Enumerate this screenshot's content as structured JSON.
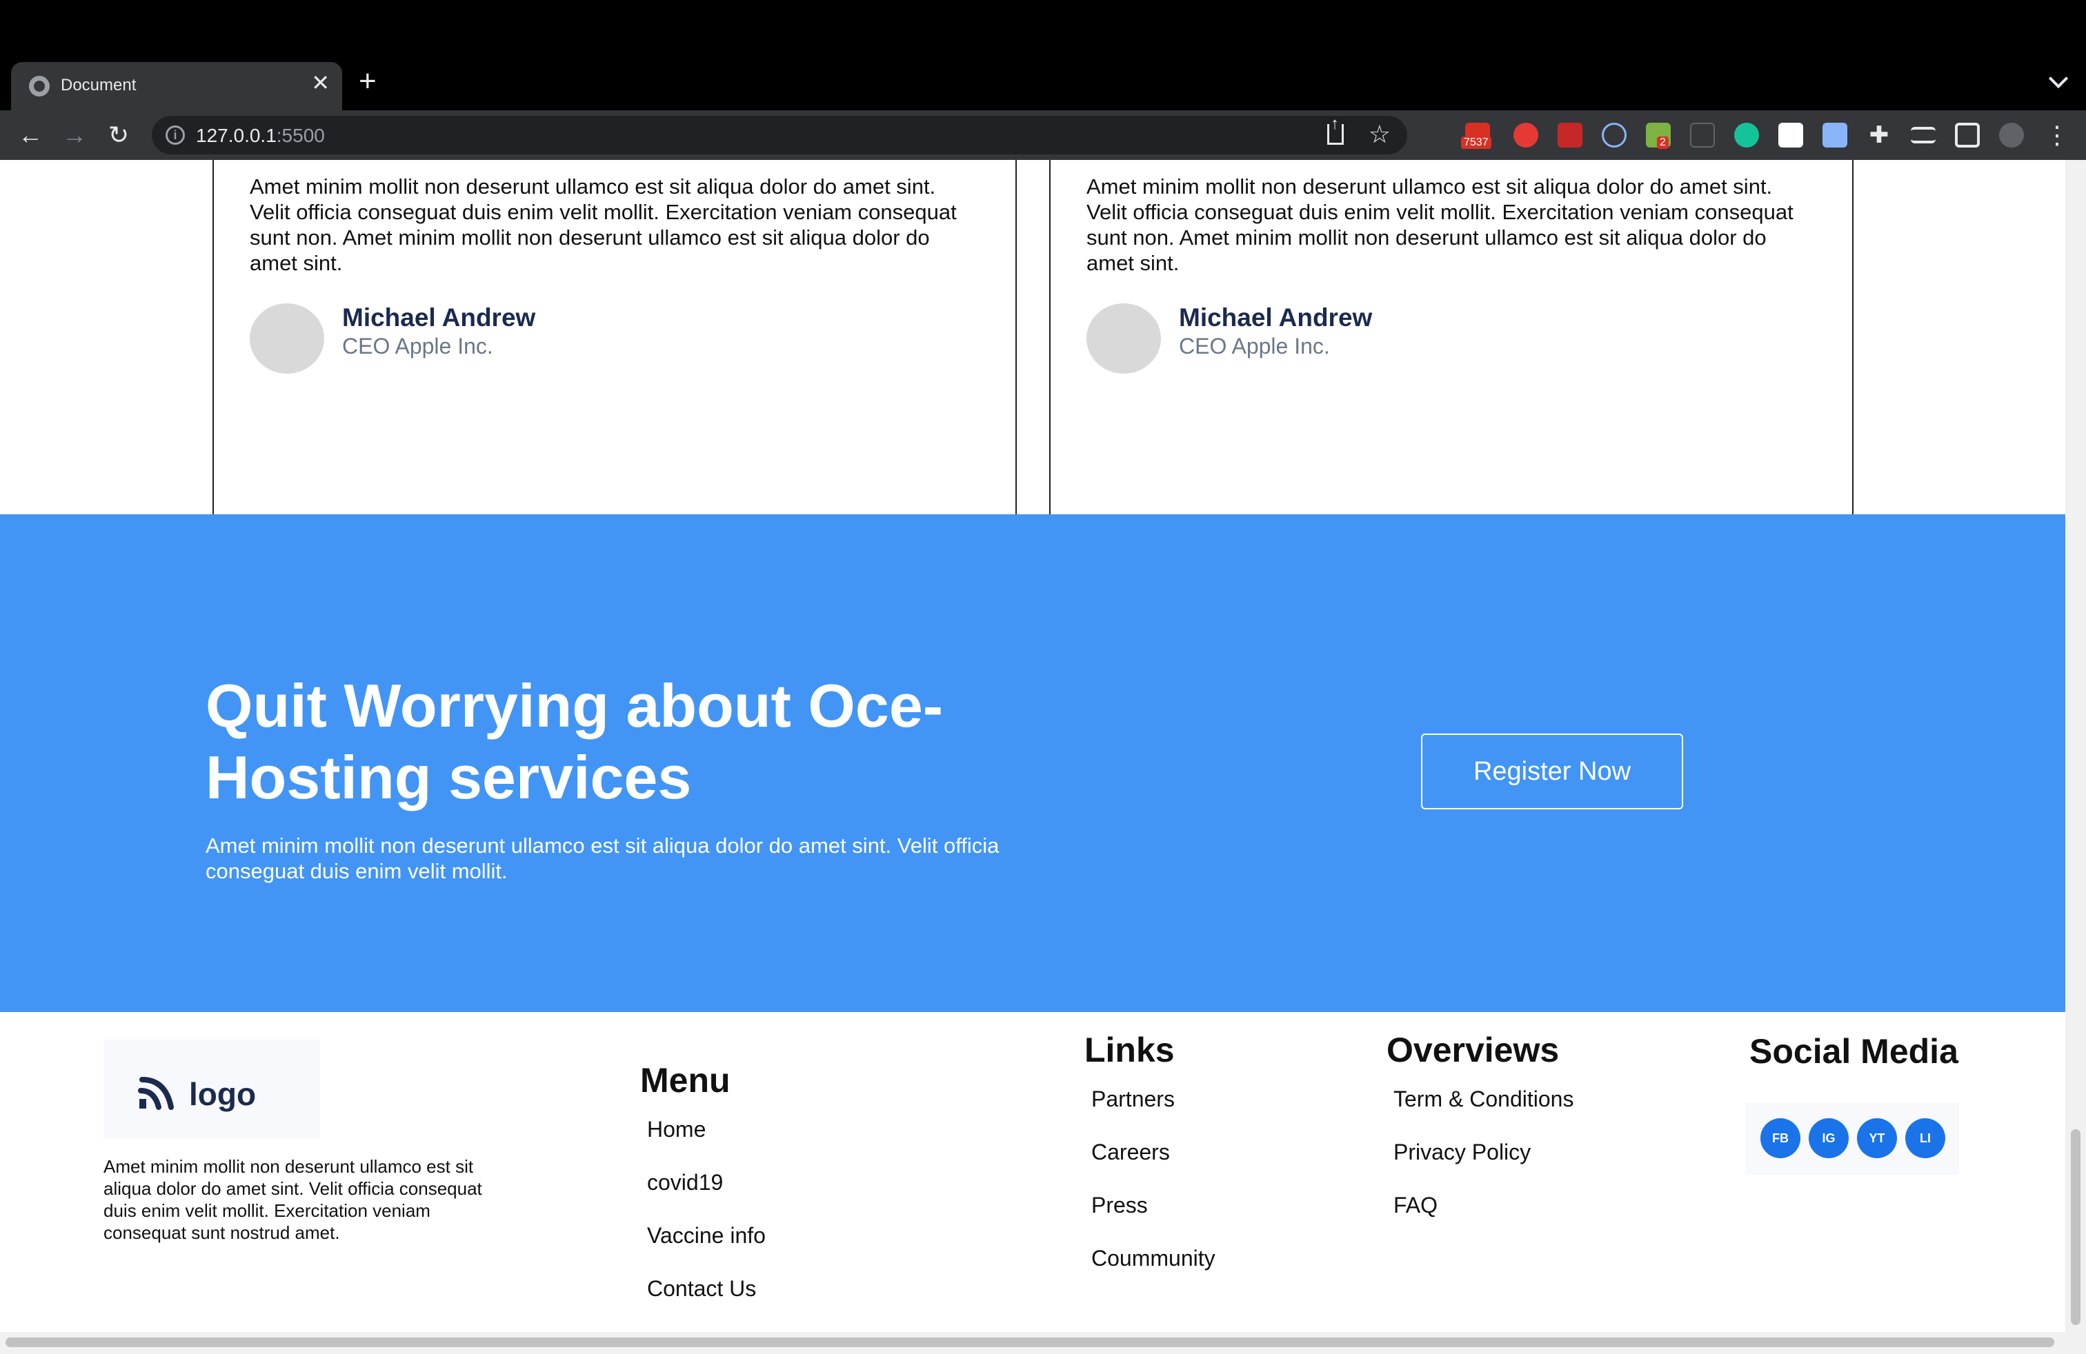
{
  "browser": {
    "tab_title": "Document",
    "tab_close": "✕",
    "new_tab": "+",
    "url_host": "127.0.0.1",
    "url_port": ":5500",
    "extension_badge_mail": "7537",
    "extension_badge_news": "2"
  },
  "testimonials": [
    {
      "text": "Amet minim mollit non deserunt ullamco est sit aliqua dolor do amet sint. Velit officia conseguat duis enim velit mollit. Exercitation veniam consequat sunt non. Amet minim mollit non deserunt ullamco est sit aliqua dolor do amet sint.",
      "name": "Michael Andrew",
      "role": "CEO Apple Inc."
    },
    {
      "text": "Amet minim mollit non deserunt ullamco est sit aliqua dolor do amet sint. Velit officia conseguat duis enim velit mollit. Exercitation veniam consequat sunt non. Amet minim mollit non deserunt ullamco est sit aliqua dolor do amet sint.",
      "name": "Michael Andrew",
      "role": "CEO Apple Inc."
    }
  ],
  "cta": {
    "title": "Quit Worrying about Oce-Hosting services",
    "text": "Amet minim mollit non deserunt ullamco est sit aliqua dolor do amet sint. Velit officia conseguat duis enim velit mollit.",
    "button_label": "Register Now",
    "background_color": "#4295f5"
  },
  "footer": {
    "logo_text": "logo",
    "about": "Amet minim mollit non deserunt ullamco est sit aliqua dolor do amet sint. Velit officia consequat duis enim velit mollit. Exercitation veniam consequat sunt nostrud amet.",
    "menu": {
      "heading": "Menu",
      "items": [
        "Home",
        "covid19",
        "Vaccine info",
        "Contact Us"
      ]
    },
    "links": {
      "heading": "Links",
      "items": [
        "Partners",
        "Careers",
        "Press",
        "Coummunity"
      ]
    },
    "overviews": {
      "heading": "Overviews",
      "items": [
        "Term & Conditions",
        "Privacy Policy",
        "FAQ"
      ]
    },
    "social": {
      "heading": "Social Media",
      "items": [
        "FB",
        "IG",
        "YT",
        "LI"
      ]
    }
  }
}
